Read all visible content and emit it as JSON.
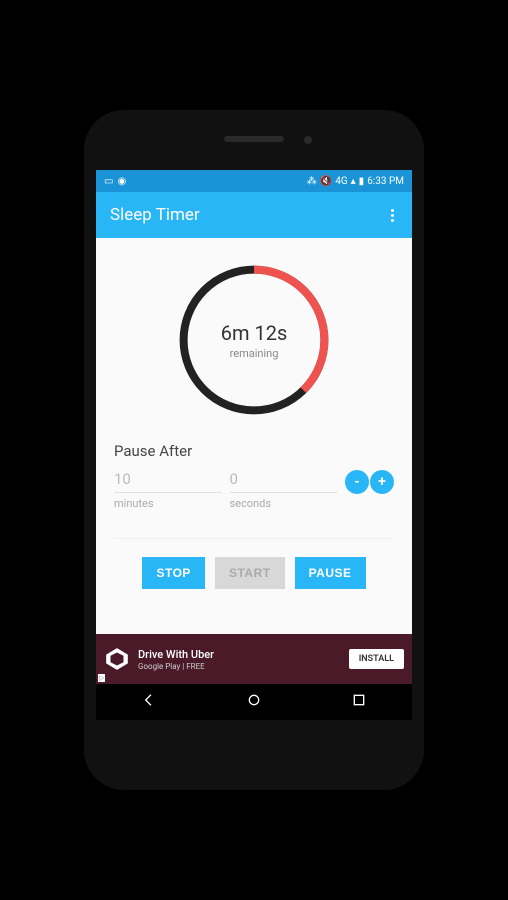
{
  "statusbar": {
    "time": "6:33 PM",
    "network": "4G"
  },
  "appbar": {
    "title": "Sleep Timer"
  },
  "timer": {
    "time": "6m 12s",
    "label": "remaining"
  },
  "pause_after": {
    "label": "Pause After",
    "minutes": {
      "value": "10",
      "label": "minutes"
    },
    "seconds": {
      "value": "0",
      "label": "seconds"
    },
    "minus": "-",
    "plus": "+"
  },
  "buttons": {
    "stop": "STOP",
    "start": "START",
    "pause": "PAUSE"
  },
  "ad": {
    "title": "Drive With Uber",
    "sub": "Google Play  |  FREE",
    "cta": "INSTALL"
  }
}
